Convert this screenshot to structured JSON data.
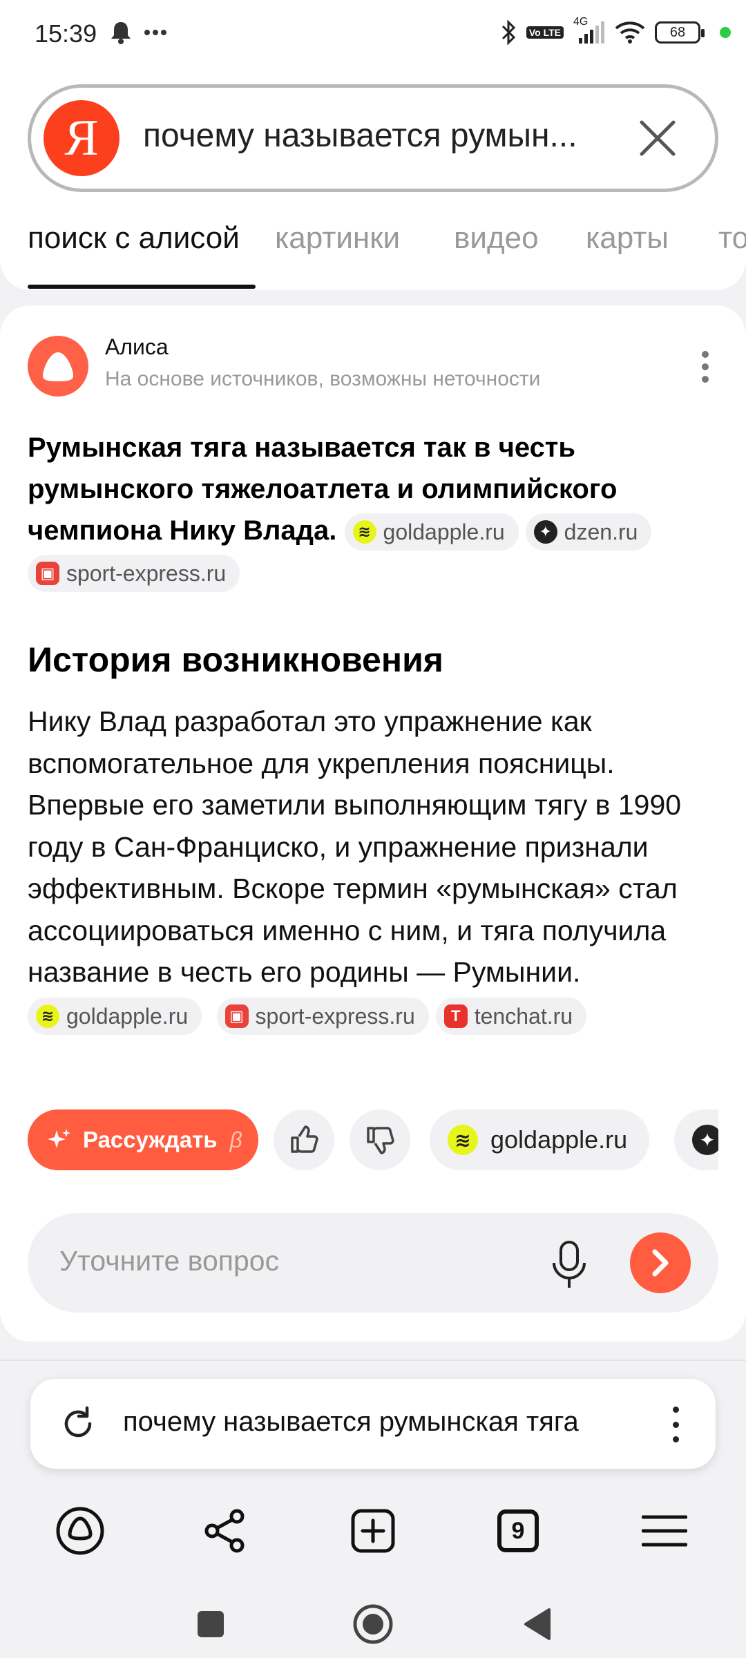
{
  "status_bar": {
    "time": "15:39",
    "battery": "68",
    "network": "4G",
    "volte": "Vo LTE"
  },
  "search": {
    "query": "почему называется румын...",
    "logo_letter": "Я"
  },
  "tabs": [
    {
      "label": "поиск с алисой",
      "active": true
    },
    {
      "label": "картинки",
      "active": false
    },
    {
      "label": "видео",
      "active": false
    },
    {
      "label": "карты",
      "active": false
    },
    {
      "label": "то",
      "active": false
    }
  ],
  "answer": {
    "author": "Алиса",
    "disclaimer": "На основе источников, возможны неточности",
    "summary": "Румынская тяга называется так в честь румынского тяжелоатлета и олимпийского чемпиона Нику Влада",
    "summary_end": ".",
    "summary_sources": [
      {
        "label": "goldapple.ru",
        "icon": "goldapple-icon",
        "glyph": "≋"
      },
      {
        "label": "dzen.ru",
        "icon": "dzen-icon",
        "glyph": "✦"
      },
      {
        "label": "sport-express.ru",
        "icon": "sport-express-icon",
        "glyph": "▣"
      }
    ],
    "section_title": "История возникновения",
    "section_text": "Нику Влад разработал это упражнение как вспомогательное для укрепления поясницы. Впервые его заметили выполняющим тягу в 1990 году в Сан-Франциско, и упражнение признали эффективным. Вскоре термин «румынская» стал ассоциироваться именно с ним, и тяга получила название в честь его родины — Румынии.",
    "section_sources": [
      {
        "label": "goldapple.ru",
        "icon": "goldapple-icon",
        "glyph": "≋"
      },
      {
        "label": "sport-express.ru",
        "icon": "sport-express-icon",
        "glyph": "▣"
      },
      {
        "label": "tenchat.ru",
        "icon": "tenchat-icon",
        "glyph": "T"
      }
    ]
  },
  "actions": {
    "reason_label": "Рассуждать",
    "reason_beta": "β",
    "chip_goldapple": "goldapple.ru",
    "chip_goldapple_glyph": "≋",
    "chip_next_glyph": "✦"
  },
  "followup": {
    "placeholder": "Уточните вопрос"
  },
  "bottom": {
    "query": "почему называется румынская тяга",
    "tabs_count": "9"
  },
  "colors": {
    "accent": "#ff5c40",
    "yandex_red": "#fc3f1d",
    "text_secondary": "#999999"
  }
}
